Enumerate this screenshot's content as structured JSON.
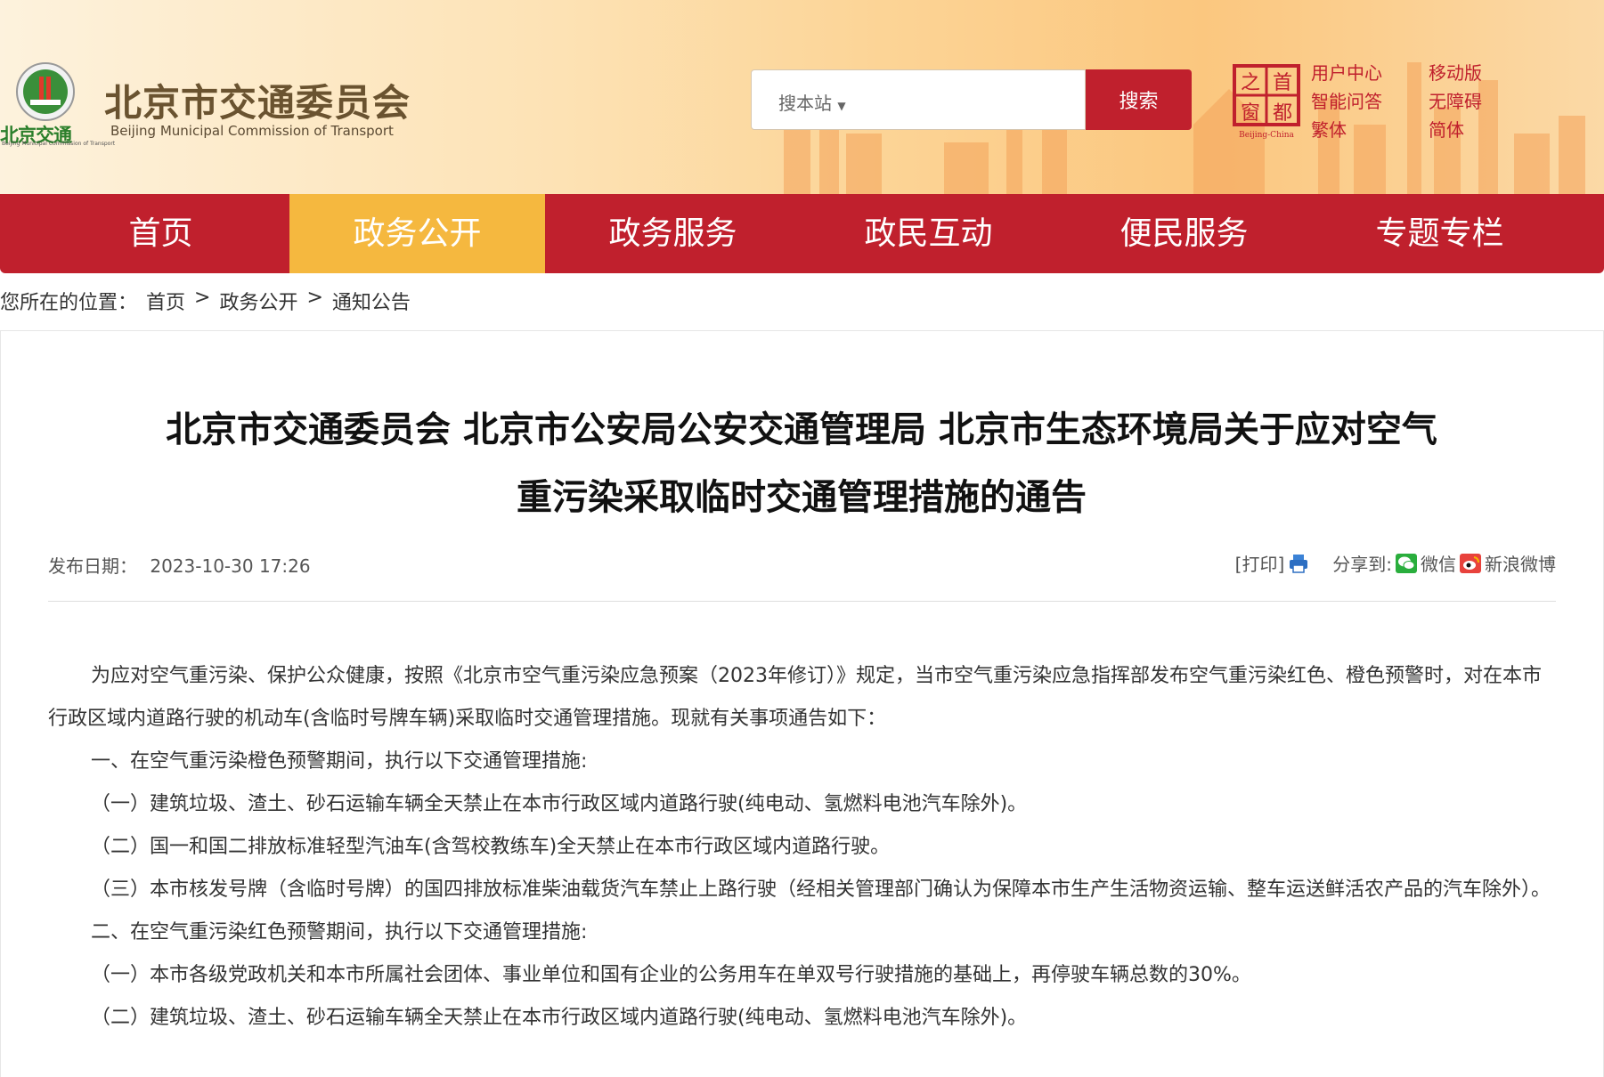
{
  "header": {
    "logo_mini": "北京交通",
    "logo_mini_sub": "Beijing Municipal Commission of Transport",
    "site_title": "北京市交通委员会",
    "site_title_en": "Beijing Municipal Commission of Transport",
    "search_scope": "搜本站",
    "search_placeholder": "",
    "search_button": "搜索",
    "capital_logo_text": "首都之窗",
    "capital_logo_en": "Beijing-China",
    "links": {
      "user_center": "用户中心",
      "mobile": "移动版",
      "smart_qa": "智能问答",
      "accessibility": "无障碍",
      "traditional": "繁体",
      "simplified": "简体"
    }
  },
  "nav": {
    "items": [
      "首页",
      "政务公开",
      "政务服务",
      "政民互动",
      "便民服务",
      "专题专栏"
    ],
    "active_index": 1
  },
  "breadcrumb": {
    "prefix": "您所在的位置：",
    "items": [
      "首页",
      "政务公开",
      "通知公告"
    ],
    "separator": ">"
  },
  "article": {
    "title_line1": "北京市交通委员会 北京市公安局公安交通管理局 北京市生态环境局关于应对空气",
    "title_line2": "重污染采取临时交通管理措施的通告",
    "date_label": "发布日期：",
    "date_value": "2023-10-30 17:26",
    "print_label": "[打印]",
    "share_label": "分享到:",
    "share_wechat": "微信",
    "share_weibo": "新浪微博",
    "paragraphs": [
      "为应对空气重污染、保护公众健康，按照《北京市空气重污染应急预案（2023年修订）》规定，当市空气重污染应急指挥部发布空气重污染红色、橙色预警时，对在本市行政区域内道路行驶的机动车(含临时号牌车辆)采取临时交通管理措施。现就有关事项通告如下：",
      "一、在空气重污染橙色预警期间，执行以下交通管理措施:",
      "（一）建筑垃圾、渣土、砂石运输车辆全天禁止在本市行政区域内道路行驶(纯电动、氢燃料电池汽车除外)。",
      "（二）国一和国二排放标准轻型汽油车(含驾校教练车)全天禁止在本市行政区域内道路行驶。",
      "（三）本市核发号牌（含临时号牌）的国四排放标准柴油载货汽车禁止上路行驶（经相关管理部门确认为保障本市生产生活物资运输、整车运送鲜活农产品的汽车除外）。",
      "二、在空气重污染红色预警期间，执行以下交通管理措施:",
      "（一）本市各级党政机关和本市所属社会团体、事业单位和国有企业的公务用车在单双号行驶措施的基础上，再停驶车辆总数的30%。",
      "（二）建筑垃圾、渣土、砂石运输车辆全天禁止在本市行政区域内道路行驶(纯电动、氢燃料电池汽车除外)。"
    ]
  },
  "colors": {
    "brand_red": "#c0202d",
    "nav_active": "#f5b83f",
    "logo_brown": "#6a5330",
    "logo_green": "#2b7f2b"
  }
}
